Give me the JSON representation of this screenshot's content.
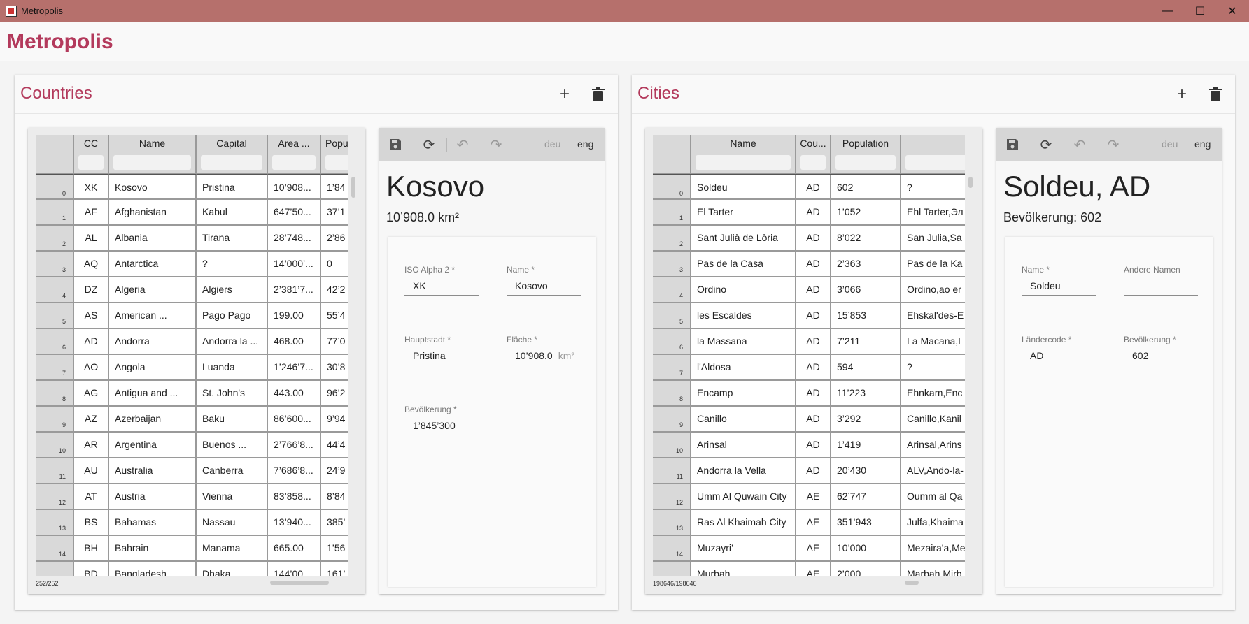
{
  "window": {
    "title": "Metropolis",
    "controls": {
      "minimize": "—",
      "maximize": "☐",
      "close": "✕"
    }
  },
  "app": {
    "brand": "Metropolis"
  },
  "countries": {
    "panel_title": "Countries",
    "add_icon": "+",
    "delete_icon": "🗑",
    "columns": [
      "CC",
      "Name",
      "Capital",
      "Area ...",
      "Popu"
    ],
    "rows": [
      {
        "i": "0",
        "cc": "XK",
        "name": "Kosovo",
        "capital": "Pristina",
        "area": "10’908...",
        "pop": "1’84"
      },
      {
        "i": "1",
        "cc": "AF",
        "name": "Afghanistan",
        "capital": "Kabul",
        "area": "647’50...",
        "pop": "37’1"
      },
      {
        "i": "2",
        "cc": "AL",
        "name": "Albania",
        "capital": "Tirana",
        "area": "28’748...",
        "pop": "2’86"
      },
      {
        "i": "3",
        "cc": "AQ",
        "name": "Antarctica",
        "capital": "?",
        "area": "14’000’...",
        "pop": "0"
      },
      {
        "i": "4",
        "cc": "DZ",
        "name": "Algeria",
        "capital": "Algiers",
        "area": "2’381’7...",
        "pop": "42’2"
      },
      {
        "i": "5",
        "cc": "AS",
        "name": "American ...",
        "capital": "Pago Pago",
        "area": "199.00",
        "pop": "55’4"
      },
      {
        "i": "6",
        "cc": "AD",
        "name": "Andorra",
        "capital": "Andorra la ...",
        "area": "468.00",
        "pop": "77’0"
      },
      {
        "i": "7",
        "cc": "AO",
        "name": "Angola",
        "capital": "Luanda",
        "area": "1’246’7...",
        "pop": "30’8"
      },
      {
        "i": "8",
        "cc": "AG",
        "name": "Antigua and ...",
        "capital": "St. John's",
        "area": "443.00",
        "pop": "96’2"
      },
      {
        "i": "9",
        "cc": "AZ",
        "name": "Azerbaijan",
        "capital": "Baku",
        "area": "86’600...",
        "pop": "9’94"
      },
      {
        "i": "10",
        "cc": "AR",
        "name": "Argentina",
        "capital": "Buenos ...",
        "area": "2’766’8...",
        "pop": "44’4"
      },
      {
        "i": "11",
        "cc": "AU",
        "name": "Australia",
        "capital": "Canberra",
        "area": "7’686’8...",
        "pop": "24’9"
      },
      {
        "i": "12",
        "cc": "AT",
        "name": "Austria",
        "capital": "Vienna",
        "area": "83’858...",
        "pop": "8’84"
      },
      {
        "i": "13",
        "cc": "BS",
        "name": "Bahamas",
        "capital": "Nassau",
        "area": "13’940...",
        "pop": "385’"
      },
      {
        "i": "14",
        "cc": "BH",
        "name": "Bahrain",
        "capital": "Manama",
        "area": "665.00",
        "pop": "1’56"
      },
      {
        "i": "15",
        "cc": "BD",
        "name": "Bangladesh",
        "capital": "Dhaka",
        "area": "144’00...",
        "pop": "161’"
      }
    ],
    "counter": "252/252",
    "detail": {
      "toolbar": {
        "save_icon": "💾",
        "refresh_icon": "⟳",
        "undo_icon": "↶",
        "redo_icon": "↷",
        "lang_de": "deu",
        "lang_en": "eng"
      },
      "title": "Kosovo",
      "subtitle": "10’908.0 km²",
      "fields": {
        "iso_label": "ISO Alpha 2 *",
        "iso_value": "XK",
        "name_label": "Name *",
        "name_value": "Kosovo",
        "capital_label": "Hauptstadt *",
        "capital_value": "Pristina",
        "area_label": "Fläche *",
        "area_value": "10’908.0",
        "area_unit": "km²",
        "pop_label": "Bevölkerung *",
        "pop_value": "1’845’300"
      }
    }
  },
  "cities": {
    "panel_title": "Cities",
    "add_icon": "+",
    "delete_icon": "🗑",
    "columns": [
      "Name",
      "Cou...",
      "Population",
      ""
    ],
    "rows": [
      {
        "i": "0",
        "name": "Soldeu",
        "cc": "AD",
        "pop": "602",
        "alt": "?"
      },
      {
        "i": "1",
        "name": "El Tarter",
        "cc": "AD",
        "pop": "1’052",
        "alt": "Ehl Tarter,Эл"
      },
      {
        "i": "2",
        "name": "Sant Julià de Lòria",
        "cc": "AD",
        "pop": "8’022",
        "alt": "San Julia,Sa"
      },
      {
        "i": "3",
        "name": "Pas de la Casa",
        "cc": "AD",
        "pop": "2’363",
        "alt": "Pas de la Ka"
      },
      {
        "i": "4",
        "name": "Ordino",
        "cc": "AD",
        "pop": "3’066",
        "alt": "Ordino,ao er"
      },
      {
        "i": "5",
        "name": "les Escaldes",
        "cc": "AD",
        "pop": "15’853",
        "alt": "Ehskal'des-E"
      },
      {
        "i": "6",
        "name": "la Massana",
        "cc": "AD",
        "pop": "7’211",
        "alt": "La Macana,L"
      },
      {
        "i": "7",
        "name": "l'Aldosa",
        "cc": "AD",
        "pop": "594",
        "alt": "?"
      },
      {
        "i": "8",
        "name": "Encamp",
        "cc": "AD",
        "pop": "11’223",
        "alt": "Ehnkam,Enc"
      },
      {
        "i": "9",
        "name": "Canillo",
        "cc": "AD",
        "pop": "3’292",
        "alt": "Canillo,Kanil"
      },
      {
        "i": "10",
        "name": "Arinsal",
        "cc": "AD",
        "pop": "1’419",
        "alt": "Arinsal,Arins"
      },
      {
        "i": "11",
        "name": "Andorra la Vella",
        "cc": "AD",
        "pop": "20’430",
        "alt": "ALV,Ando-la-"
      },
      {
        "i": "12",
        "name": "Umm Al Quwain City",
        "cc": "AE",
        "pop": "62’747",
        "alt": "Oumm al Qa"
      },
      {
        "i": "13",
        "name": "Ras Al Khaimah City",
        "cc": "AE",
        "pop": "351’943",
        "alt": "Julfa,Khaima"
      },
      {
        "i": "14",
        "name": "Muzayri’",
        "cc": "AE",
        "pop": "10’000",
        "alt": "Mezaira'a,Me"
      },
      {
        "i": "15",
        "name": "Murbah",
        "cc": "AE",
        "pop": "2’000",
        "alt": "Marbah,Mirb"
      }
    ],
    "counter": "198646/198646",
    "detail": {
      "toolbar": {
        "save_icon": "💾",
        "refresh_icon": "⟳",
        "undo_icon": "↶",
        "redo_icon": "↷",
        "lang_de": "deu",
        "lang_en": "eng"
      },
      "title": "Soldeu, AD",
      "subtitle": "Bevölkerung: 602",
      "fields": {
        "name_label": "Name *",
        "name_value": "Soldeu",
        "other_label": "Andere Namen",
        "other_value": "",
        "cc_label": "Ländercode *",
        "cc_value": "AD",
        "pop_label": "Bevölkerung *",
        "pop_value": "602"
      }
    }
  },
  "colors": {
    "titlebar": "#b6706c",
    "accent": "#b33a5c"
  }
}
